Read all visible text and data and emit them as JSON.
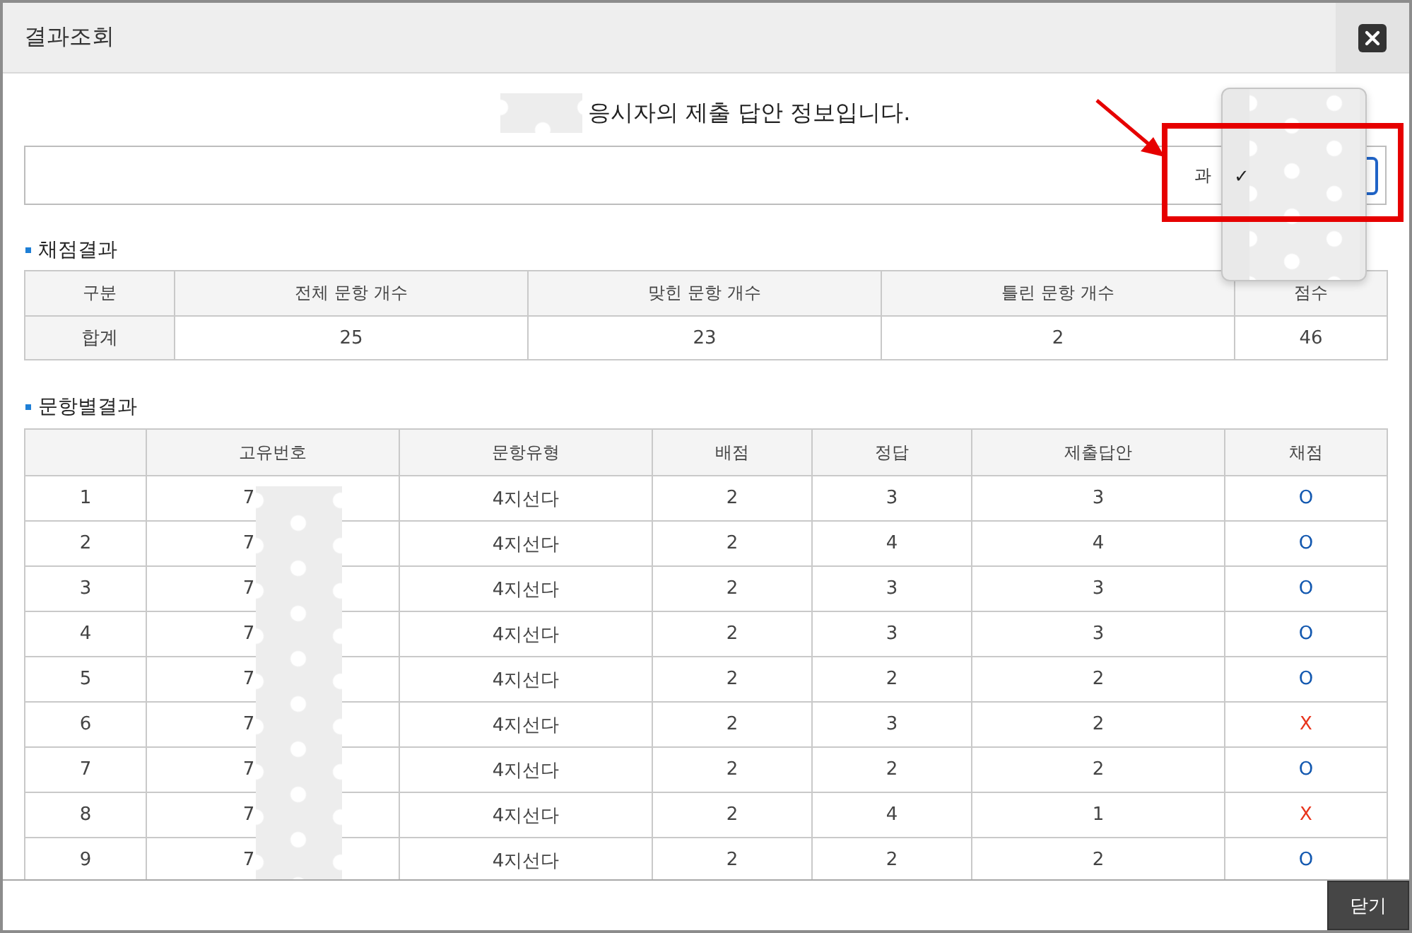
{
  "dialog": {
    "title": "결과조회"
  },
  "heading": "응시자의 제출 답안 정보입니다.",
  "filter": {
    "label": "과"
  },
  "dropdown": {
    "check": "✓",
    "items": [
      {
        "selected": false
      },
      {
        "selected": false
      },
      {
        "selected": true
      },
      {
        "selected": false
      },
      {
        "selected": false
      },
      {
        "selected": false
      }
    ]
  },
  "summary": {
    "title": "채점결과",
    "columns": [
      "구분",
      "전체 문항 개수",
      "맞힌 문항 개수",
      "틀린 문항 개수",
      "점수"
    ],
    "rows": [
      [
        "합계",
        "25",
        "23",
        "2",
        "46"
      ]
    ]
  },
  "detail": {
    "title": "문항별결과",
    "columns": [
      "고유번호",
      "문항유형",
      "배점",
      "정답",
      "제출답안",
      "채점"
    ],
    "rows": [
      {
        "no": "1",
        "id": "7",
        "type": "4지선다",
        "points": "2",
        "answer": "3",
        "submitted": "3",
        "mark": "O",
        "correct": true
      },
      {
        "no": "2",
        "id": "7",
        "type": "4지선다",
        "points": "2",
        "answer": "4",
        "submitted": "4",
        "mark": "O",
        "correct": true
      },
      {
        "no": "3",
        "id": "7",
        "type": "4지선다",
        "points": "2",
        "answer": "3",
        "submitted": "3",
        "mark": "O",
        "correct": true
      },
      {
        "no": "4",
        "id": "7",
        "type": "4지선다",
        "points": "2",
        "answer": "3",
        "submitted": "3",
        "mark": "O",
        "correct": true
      },
      {
        "no": "5",
        "id": "7",
        "type": "4지선다",
        "points": "2",
        "answer": "2",
        "submitted": "2",
        "mark": "O",
        "correct": true
      },
      {
        "no": "6",
        "id": "7",
        "type": "4지선다",
        "points": "2",
        "answer": "3",
        "submitted": "2",
        "mark": "X",
        "correct": false
      },
      {
        "no": "7",
        "id": "7",
        "type": "4지선다",
        "points": "2",
        "answer": "2",
        "submitted": "2",
        "mark": "O",
        "correct": true
      },
      {
        "no": "8",
        "id": "7",
        "type": "4지선다",
        "points": "2",
        "answer": "4",
        "submitted": "1",
        "mark": "X",
        "correct": false
      },
      {
        "no": "9",
        "id": "7",
        "type": "4지선다",
        "points": "2",
        "answer": "2",
        "submitted": "2",
        "mark": "O",
        "correct": true
      }
    ]
  },
  "footer": {
    "close_button": "닫기"
  }
}
